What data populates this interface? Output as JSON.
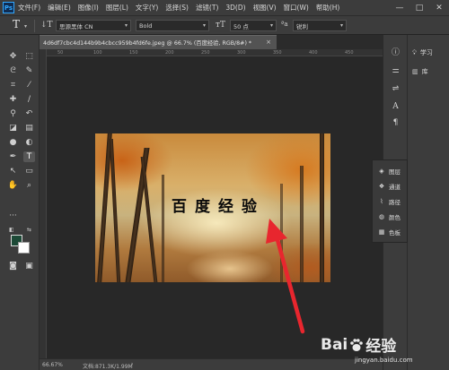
{
  "app": {
    "logo": "Ps"
  },
  "menu": [
    "文件(F)",
    "编辑(E)",
    "图像(I)",
    "图层(L)",
    "文字(Y)",
    "选择(S)",
    "滤镜(T)",
    "3D(D)",
    "视图(V)",
    "窗口(W)",
    "帮助(H)"
  ],
  "window_controls": {
    "minimize": "—",
    "maximize": "□",
    "close": "✕"
  },
  "options": {
    "font_family": "思源黑体 CN",
    "font_style": "Bold",
    "font_size": "50 点",
    "anti_alias": "锐利"
  },
  "document": {
    "tab_title": "4d6df7cbc4d144b9b4cbcc959b4fd6fe.jpeg @ 66.7% (百度经验, RGB/8#) *",
    "close": "×"
  },
  "canvas": {
    "text_layer": "百度经验"
  },
  "status": {
    "zoom": "66.67%",
    "doc_size": "文档:871.3K/1.99M"
  },
  "learn_panel": {
    "learn": "学习",
    "library": "库"
  },
  "layers_panel": {
    "items": [
      {
        "icon": "layers-icon",
        "label": "图层"
      },
      {
        "icon": "channels-icon",
        "label": "通道"
      },
      {
        "icon": "paths-icon",
        "label": "路径"
      },
      {
        "icon": "color-icon",
        "label": "颜色"
      },
      {
        "icon": "swatches-icon",
        "label": "色板"
      }
    ]
  },
  "colors": {
    "foreground": "#1d4a37",
    "background": "#ffffff",
    "arrow": "#e8262e"
  },
  "watermark": {
    "main_left": "Bai",
    "main_right": "经验",
    "sub": "jingyan.baidu.com"
  }
}
